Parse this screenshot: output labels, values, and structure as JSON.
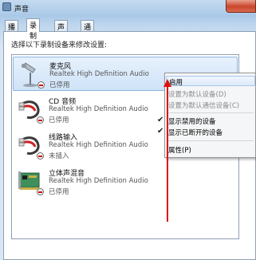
{
  "window": {
    "title": "声音"
  },
  "tabs": [
    {
      "label": "播放"
    },
    {
      "label": "录制"
    },
    {
      "label": "声音"
    },
    {
      "label": "通信"
    }
  ],
  "panel": {
    "instruction": "选择以下录制设备来修改设置:"
  },
  "devices": [
    {
      "name": "麦克风",
      "description": "Realtek High Definition Audio",
      "status": "已停用",
      "icon": "microphone-icon"
    },
    {
      "name": "CD 音频",
      "description": "Realtek High Definition Audio",
      "status": "已停用",
      "icon": "cd-audio-cable-icon"
    },
    {
      "name": "线路输入",
      "description": "Realtek High Definition Audio",
      "status": "未插入",
      "icon": "line-in-cable-icon"
    },
    {
      "name": "立体声混音",
      "description": "Realtek High Definition Audio",
      "status": "已停用",
      "icon": "sound-card-icon"
    }
  ],
  "context_menu": {
    "items": [
      {
        "label": "启用",
        "enabled": true,
        "checked": false
      },
      {
        "label": "设置为默认设备(D)",
        "enabled": false,
        "checked": false
      },
      {
        "label": "设置为默认通信设备(C)",
        "enabled": false,
        "checked": false
      },
      {
        "label": "显示禁用的设备",
        "enabled": true,
        "checked": true
      },
      {
        "label": "显示已断开的设备",
        "enabled": true,
        "checked": true
      },
      {
        "label": "属性(P)",
        "enabled": true,
        "checked": false
      }
    ]
  },
  "colors": {
    "accent_arrow": "#dd1111",
    "selection": "#cfe3f8",
    "status_red": "#cc0000"
  }
}
